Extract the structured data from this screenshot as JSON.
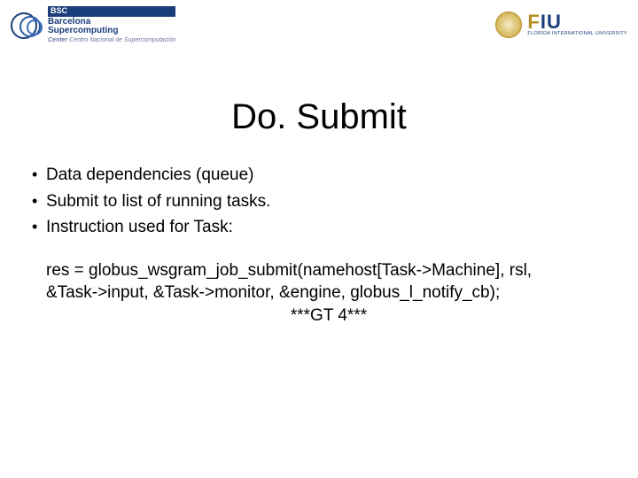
{
  "header": {
    "left_logo": {
      "abbr": "BSC",
      "line2": "Barcelona",
      "line3": "Supercomputing",
      "line4_prefix": "Center",
      "subtitle": "Centro Nacional de Supercomputación"
    },
    "right_logo": {
      "abbr_f": "F",
      "abbr_iu": "IU",
      "full": "FLORIDA INTERNATIONAL UNIVERSITY"
    }
  },
  "title": "Do. Submit",
  "bullets": [
    "Data dependencies (queue)",
    "Submit to list of running tasks.",
    "Instruction used for Task:"
  ],
  "code": {
    "line1": "res = globus_wsgram_job_submit(namehost[Task->Machine], rsl,",
    "line2": "&Task->input, &Task->monitor, &engine, globus_l_notify_cb);",
    "gt4": "***GT 4***"
  }
}
